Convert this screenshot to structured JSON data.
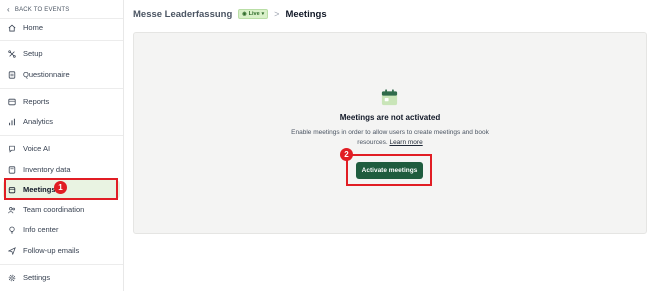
{
  "sidebar": {
    "back_label": "BACK TO EVENTS",
    "items": [
      {
        "label": "Home",
        "icon": "home-icon"
      },
      {
        "label": "Setup",
        "icon": "setup-icon"
      },
      {
        "label": "Questionnaire",
        "icon": "questionnaire-icon"
      },
      {
        "label": "Reports",
        "icon": "reports-icon"
      },
      {
        "label": "Analytics",
        "icon": "analytics-icon"
      },
      {
        "label": "Voice AI",
        "icon": "voice-ai-icon"
      },
      {
        "label": "Inventory data",
        "icon": "inventory-icon"
      },
      {
        "label": "Meetings",
        "icon": "meetings-icon",
        "active": true
      },
      {
        "label": "Team coordination",
        "icon": "team-icon"
      },
      {
        "label": "Info center",
        "icon": "info-center-icon"
      },
      {
        "label": "Follow-up emails",
        "icon": "send-icon"
      },
      {
        "label": "Settings",
        "icon": "gear-icon"
      }
    ]
  },
  "header": {
    "event_name": "Messe Leaderfassung",
    "status_badge": "Live",
    "separator": ">",
    "page_title": "Meetings"
  },
  "empty_state": {
    "title": "Meetings are not activated",
    "description": "Enable meetings in order to allow users to create meetings and book resources.",
    "learn_more": "Learn more",
    "button_label": "Activate meetings"
  },
  "annotations": {
    "step1": "1",
    "step2": "2",
    "highlight_color": "#e11d24"
  },
  "colors": {
    "brand_green": "#1f5c3e",
    "active_bg": "#e9f3e2",
    "live_bg": "#d9f0c9"
  }
}
